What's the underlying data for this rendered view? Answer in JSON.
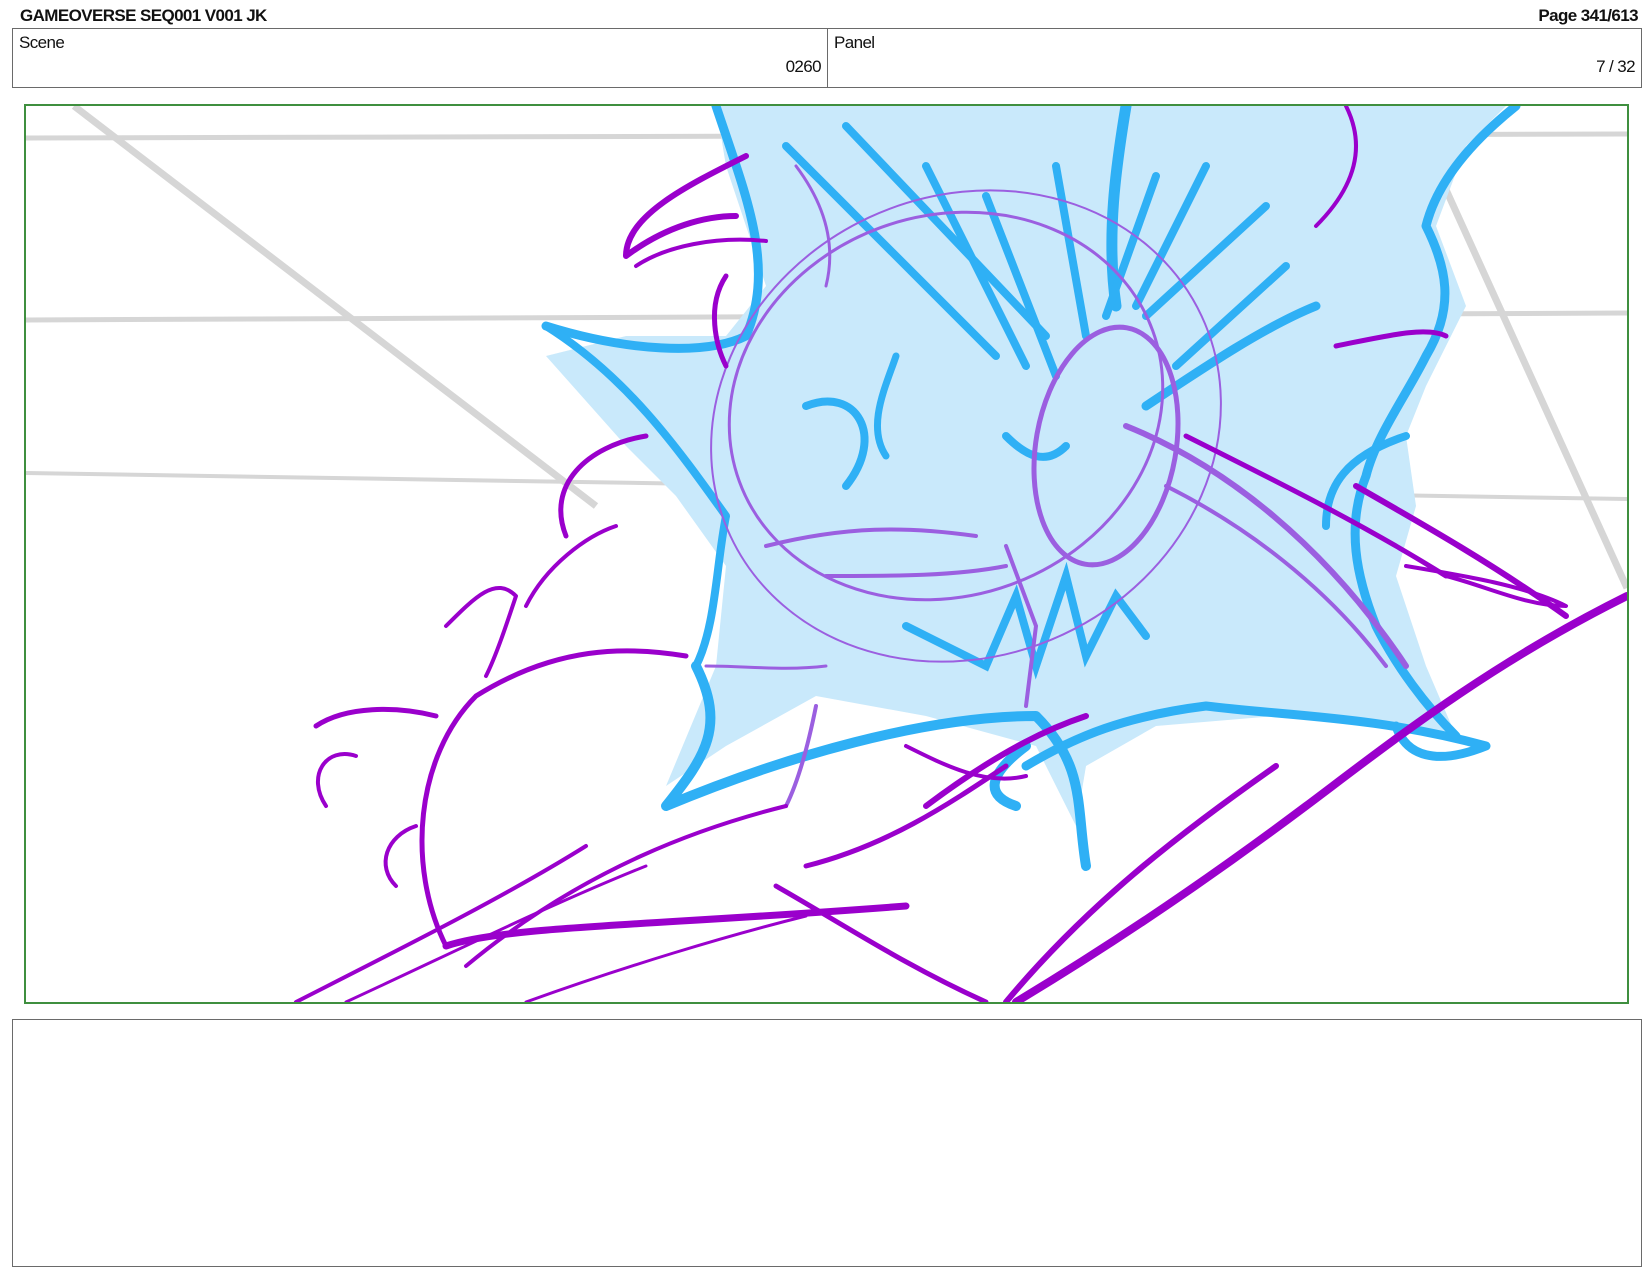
{
  "header": {
    "title": "GAMEOVERSE SEQ001 V001 JK",
    "page": "Page 341/613"
  },
  "info": {
    "scene_label": "Scene",
    "scene_value": "0260",
    "panel_label": "Panel",
    "panel_value": "7 / 32"
  },
  "colors": {
    "frame_border": "#3f8f3f",
    "sketch_purple": "#9a00cc",
    "sketch_light_purple": "#9b5fe0",
    "sketch_blue": "#2fb0f5",
    "fill_light_blue": "#c9e9fb",
    "guide_gray": "#d0d0d0"
  },
  "notes": {
    "text": ""
  }
}
